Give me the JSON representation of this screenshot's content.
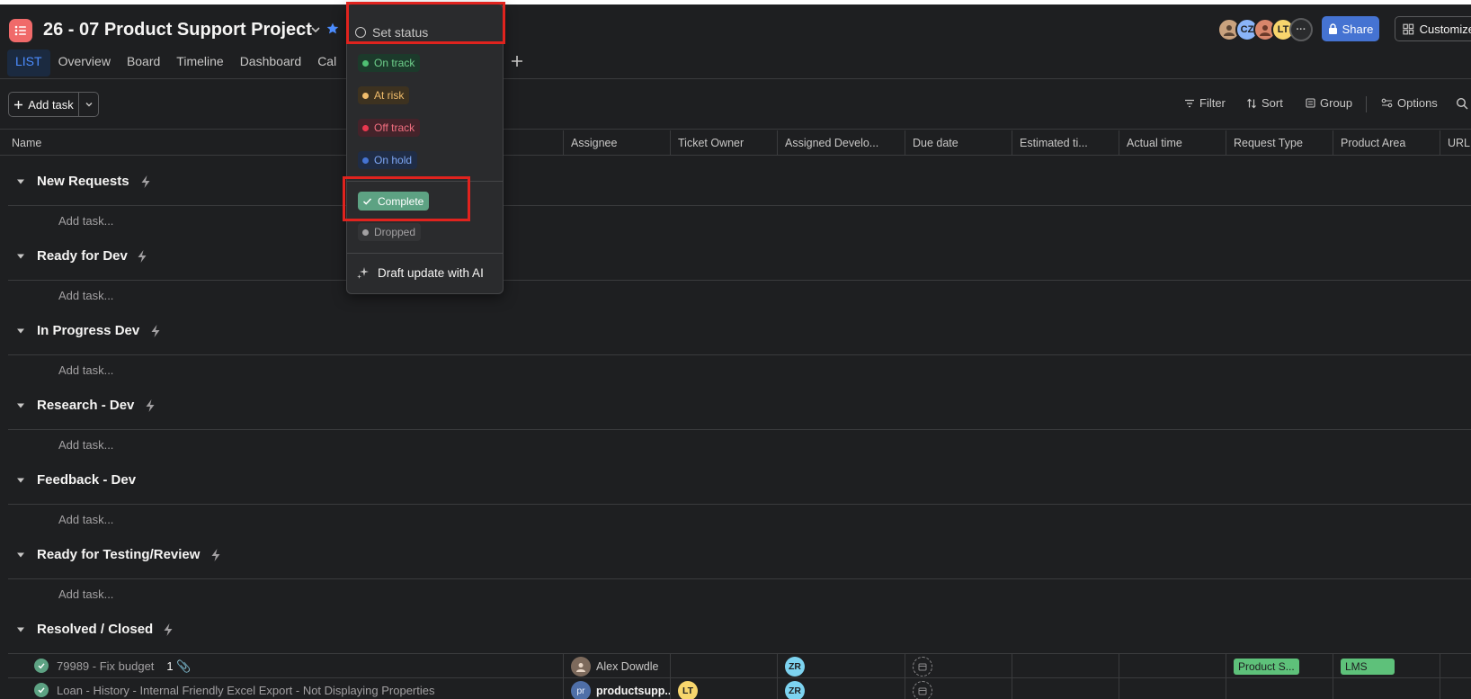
{
  "header": {
    "project_title": "26 - 07 Product Support Project",
    "tabs": [
      "LIST",
      "Overview",
      "Board",
      "Timeline",
      "Dashboard",
      "Cal"
    ],
    "avatars": [
      {
        "initials": "",
        "color": "#c9a27e"
      },
      {
        "initials": "CZ",
        "color": "#8ab4f8"
      },
      {
        "initials": "",
        "color": "#d9866b"
      },
      {
        "initials": "LT",
        "color": "#f8d66d"
      }
    ],
    "share_label": "Share",
    "customize_label": "Customize"
  },
  "toolbar": {
    "add_task_label": "Add task",
    "filter_label": "Filter",
    "sort_label": "Sort",
    "group_label": "Group",
    "options_label": "Options"
  },
  "columns": [
    "Name",
    "Assignee",
    "Ticket Owner",
    "Assigned Develo...",
    "Due date",
    "Estimated ti...",
    "Actual time",
    "Request Type",
    "Product Area",
    "URL W"
  ],
  "sections": [
    {
      "title": "New Requests",
      "add_label": "Add task..."
    },
    {
      "title": "Ready for Dev",
      "add_label": "Add task..."
    },
    {
      "title": "In Progress Dev",
      "add_label": "Add task..."
    },
    {
      "title": "Research - Dev",
      "add_label": "Add task..."
    },
    {
      "title": "Feedback - Dev",
      "add_label": "Add task..."
    },
    {
      "title": "Ready for Testing/Review",
      "add_label": "Add task..."
    },
    {
      "title": "Resolved / Closed"
    }
  ],
  "tasks": [
    {
      "name": "79989 - Fix budget",
      "attachments": "1",
      "assignee": "Alex Dowdle",
      "ticket_owner": "",
      "developer_initials": "ZR",
      "request_type": "Product S...",
      "product_area": "LMS"
    },
    {
      "name": "Loan - History - Internal Friendly Excel Export - Not Displaying Properties",
      "assignee_initials": "pr",
      "assignee": "productsupp...",
      "ticket_owner_initials": "LT",
      "developer_initials": "ZR",
      "request_type": "",
      "product_area": ""
    }
  ],
  "status_menu": {
    "title": "Set status",
    "options": [
      {
        "label": "On track",
        "bg": "#1c3a2b",
        "fg": "#6fd08c",
        "dot": "#4fbf73"
      },
      {
        "label": "At risk",
        "bg": "#3d3220",
        "fg": "#f1bd6c",
        "dot": "#f1bd6c"
      },
      {
        "label": "Off track",
        "bg": "#44232a",
        "fg": "#f26f80",
        "dot": "#e8384f"
      },
      {
        "label": "On hold",
        "bg": "#1f2c45",
        "fg": "#7ea7f5",
        "dot": "#4573d2"
      }
    ],
    "complete_label": "Complete",
    "dropped_label": "Dropped",
    "ai_label": "Draft update with AI"
  }
}
